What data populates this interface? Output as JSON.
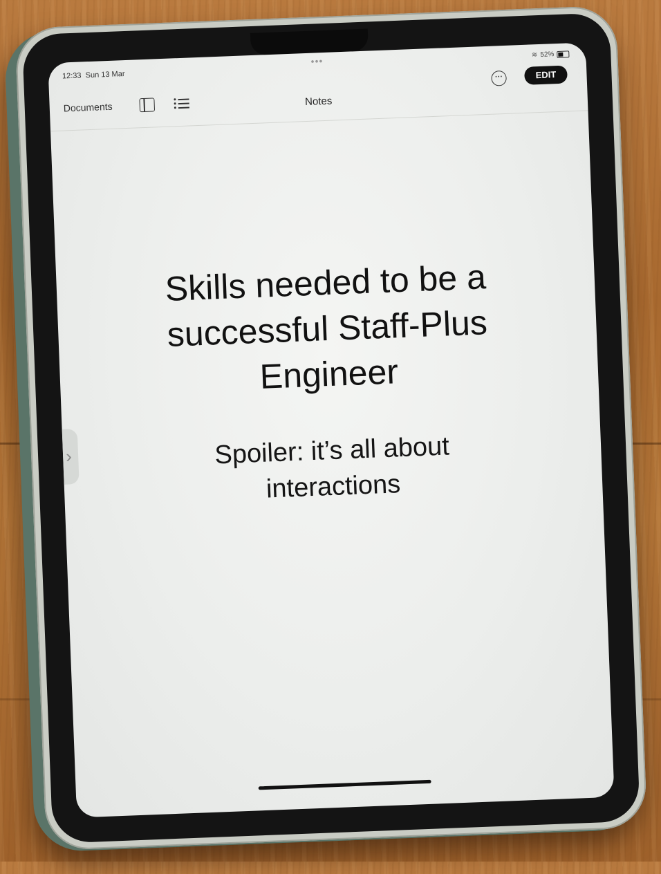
{
  "status_bar": {
    "time": "12:33",
    "date": "Sun 13 Mar",
    "battery_text": "52%",
    "battery_level": 0.52
  },
  "window_dots": "•••",
  "toolbar": {
    "documents_label": "Documents",
    "title": "Notes",
    "more_glyph": "···",
    "edit_label": "EDIT"
  },
  "content": {
    "heading": "Skills needed to be a successful Staff-Plus Engineer",
    "subheading": "Spoiler: it’s all about interactions"
  },
  "side_handle_glyph": "›",
  "icons": [
    "wifi-icon",
    "battery-icon",
    "sidebar-icon",
    "list-icon",
    "more-icon",
    "chevron-right-icon"
  ]
}
